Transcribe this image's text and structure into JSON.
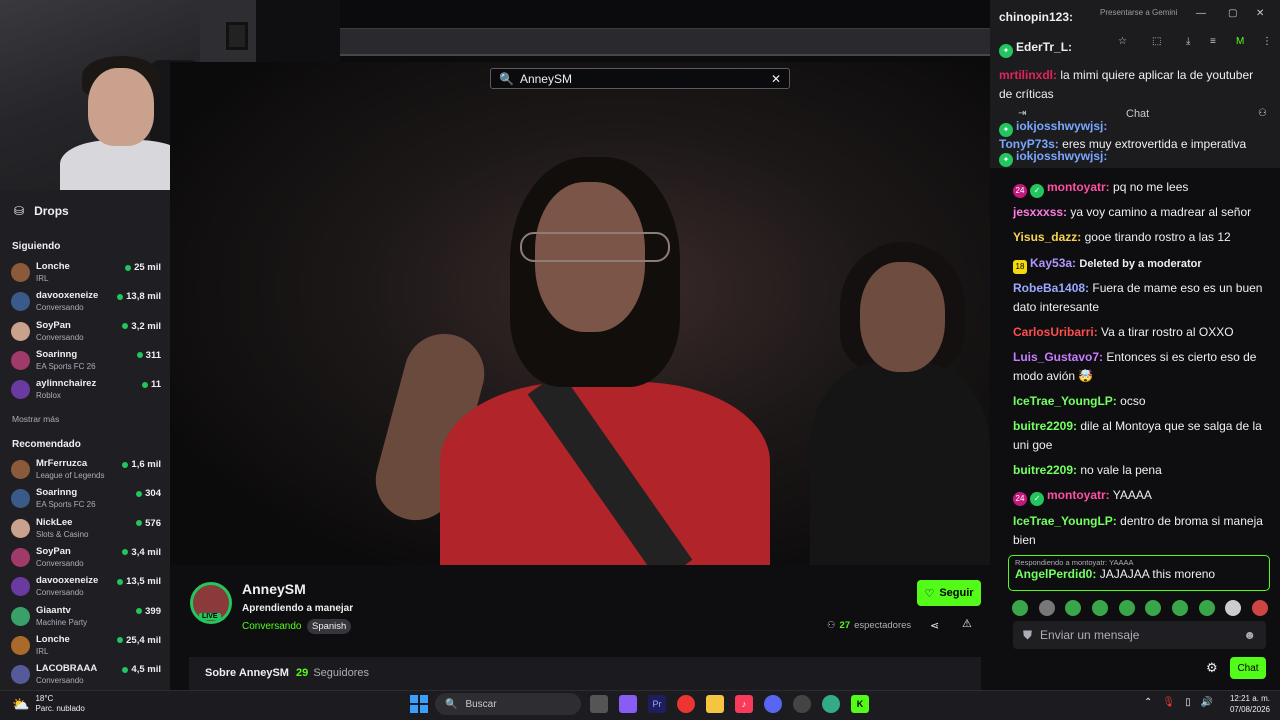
{
  "search": {
    "query": "AnneySM"
  },
  "sidebar": {
    "drops_label": "Drops",
    "following_title": "Siguiendo",
    "following": [
      {
        "name": "Lonche",
        "game": "IRL",
        "viewers": "25 mil"
      },
      {
        "name": "davooxeneize",
        "game": "Conversando",
        "viewers": "13,8 mil"
      },
      {
        "name": "SoyPan",
        "game": "Conversando",
        "viewers": "3,2 mil"
      },
      {
        "name": "Soarinng",
        "game": "EA Sports FC 26",
        "viewers": "311"
      },
      {
        "name": "aylinnchairez",
        "game": "Roblox",
        "viewers": "11"
      }
    ],
    "show_more": "Mostrar más",
    "recommended_title": "Recomendado",
    "recommended": [
      {
        "name": "MrFerruzca",
        "game": "League of Legends",
        "viewers": "1,6 mil"
      },
      {
        "name": "Soarinng",
        "game": "EA Sports FC 26",
        "viewers": "304"
      },
      {
        "name": "NickLee",
        "game": "Slots & Casino",
        "viewers": "576"
      },
      {
        "name": "SoyPan",
        "game": "Conversando",
        "viewers": "3,4 mil"
      },
      {
        "name": "davooxeneize",
        "game": "Conversando",
        "viewers": "13,5 mil"
      },
      {
        "name": "Giaantv",
        "game": "Machine Party",
        "viewers": "399"
      },
      {
        "name": "Lonche",
        "game": "IRL",
        "viewers": "25,4 mil"
      },
      {
        "name": "LACOBRAAA",
        "game": "Conversando",
        "viewers": "4,5 mil"
      }
    ]
  },
  "stream": {
    "channel": "AnneySM",
    "live_badge": "LIVE",
    "title": "Aprendiendo a manejar",
    "category": "Conversando",
    "tag": "Spanish",
    "follow_label": "Seguir",
    "viewers_count": "27",
    "viewers_label": "espectadores",
    "about_label": "Sobre AnneySM",
    "followers_count": "29",
    "followers_label": "Seguidores"
  },
  "chat": {
    "header_label": "Chat",
    "gemini_label": "Presentarse a Gemini",
    "top": [
      {
        "user": "chinopin123:",
        "text": "",
        "color": "#efeff1"
      },
      {
        "user": "EderTr_L:",
        "text": "",
        "color": "#efeff1"
      },
      {
        "user": "mrtilinxdl:",
        "text": "la mimi quiere aplicar la de youtuber de críticas",
        "color": "#e0245e"
      },
      {
        "user": "iokjosshwywjsj:",
        "text": "",
        "color": "#7aa7ff"
      },
      {
        "user": "TonyP73s:",
        "text": "eres muy extrovertida e imperativa",
        "color": "#7aa7ff"
      },
      {
        "user": "iokjosshwywjsj:",
        "text": "",
        "color": "#7aa7ff"
      }
    ],
    "messages": [
      {
        "user": "montoyatr:",
        "text": "pq no me lees",
        "color": "#ff4fa3",
        "badges": [
          "24",
          "✓"
        ]
      },
      {
        "user": "jesxxxss:",
        "text": "ya voy camino a madrear al señor",
        "color": "#ff7be0",
        "badges": []
      },
      {
        "user": "Yisus_dazz:",
        "text": "gooe tirando rostro a las 12",
        "color": "#f8d44c",
        "badges": []
      },
      {
        "user": "Kay53a:",
        "text": "Deleted by a moderator",
        "color": "#b395ff",
        "badges": [
          "18"
        ]
      },
      {
        "user": "RobeBa1408:",
        "text": "Fuera de mame eso es un buen dato interesante",
        "color": "#9aa8ff",
        "badges": []
      },
      {
        "user": "CarlosUribarri:",
        "text": "Va a tirar rostro al OXXO",
        "color": "#ff4d4d",
        "badges": []
      },
      {
        "user": "Luis_Gustavo7:",
        "text": "Entonces si es cierto eso de modo avión 🤯",
        "color": "#c77dff",
        "badges": []
      },
      {
        "user": "IceTrae_YoungLP:",
        "text": "ocso",
        "color": "#74ff62",
        "badges": []
      },
      {
        "user": "buitre2209:",
        "text": "dile al Montoya que se salga de la uni goe",
        "color": "#74ff62",
        "badges": []
      },
      {
        "user": "buitre2209:",
        "text": "no vale la pena",
        "color": "#74ff62",
        "badges": []
      },
      {
        "user": "montoyatr:",
        "text": "YAAAA",
        "color": "#ff4fa3",
        "badges": [
          "24",
          "✓"
        ]
      },
      {
        "user": "IceTrae_YoungLP:",
        "text": "dentro de broma si maneja bien",
        "color": "#74ff62",
        "badges": []
      }
    ],
    "reply": {
      "context": "Respondiendo a montoyatr: YAAAA",
      "user": "AngelPerdid0:",
      "text": "JAJAJAA this moreno",
      "color": "#74ff62"
    },
    "input_placeholder": "Enviar un mensaje",
    "send_label": "Chat"
  },
  "taskbar": {
    "temp": "18°C",
    "weather": "Parc. nublado",
    "search_label": "Buscar",
    "time": "12:21 a. m.",
    "date": "07/08/2026"
  },
  "colors": {
    "accent": "#53fc18",
    "live": "#23c55e"
  }
}
